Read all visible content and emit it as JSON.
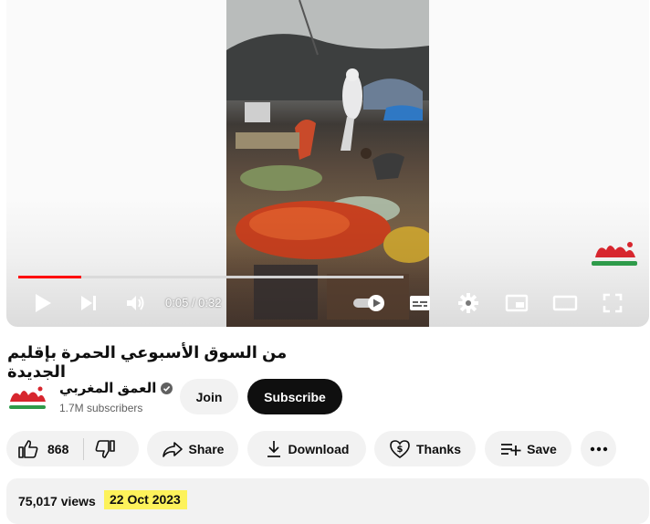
{
  "player": {
    "time_current": "0:05",
    "time_separator": " / ",
    "time_total": "0:32",
    "progress_played": 0.164,
    "progress_buffered": 1.0,
    "accent_color": "#ff0000",
    "controls": [
      "play-icon",
      "next-icon",
      "volume-icon",
      "autoplay-toggle-icon",
      "subtitles-icon",
      "settings-icon",
      "miniplayer-icon",
      "theater-mode-icon",
      "fullscreen-icon"
    ]
  },
  "video": {
    "title": "من السوق الأسبوعي الحمرة بإقليم الجديدة"
  },
  "channel": {
    "name": "العمق المغربي",
    "subscribers": "1.7M subscribers",
    "join_label": "Join",
    "subscribe_label": "Subscribe"
  },
  "actions": {
    "like_count": "868",
    "share_label": "Share",
    "download_label": "Download",
    "thanks_label": "Thanks",
    "save_label": "Save"
  },
  "description": {
    "views": "75,017 views",
    "date": "22 Oct 2023",
    "date_highlight_color": "#fdf25b"
  }
}
